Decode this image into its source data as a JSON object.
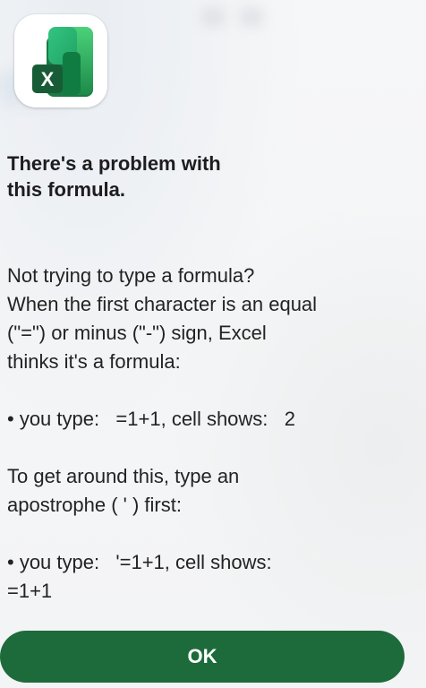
{
  "app": {
    "icon": "excel-app-icon",
    "icon_letter": "X"
  },
  "dialog": {
    "title_lines": [
      "There's a problem with",
      "this formula."
    ],
    "intro_lines": [
      "Not trying to type a formula?",
      "When the first character is an equal",
      "(\"=\") or minus (\"-\") sign, Excel",
      "thinks it's a formula:"
    ],
    "example1": "• you type:   =1+1, cell shows:   2",
    "workaround_lines": [
      "To get around this, type an",
      "apostrophe ( ' ) first:"
    ],
    "example2_lines": [
      "• you type:   '=1+1, cell shows:",
      "=1+1"
    ],
    "ok_label": "OK"
  },
  "colors": {
    "button": "#1d6b3b",
    "button_text": "#ffffff",
    "excel_dark": "#185c37",
    "excel_mid": "#21a366",
    "excel_light": "#33c481"
  }
}
